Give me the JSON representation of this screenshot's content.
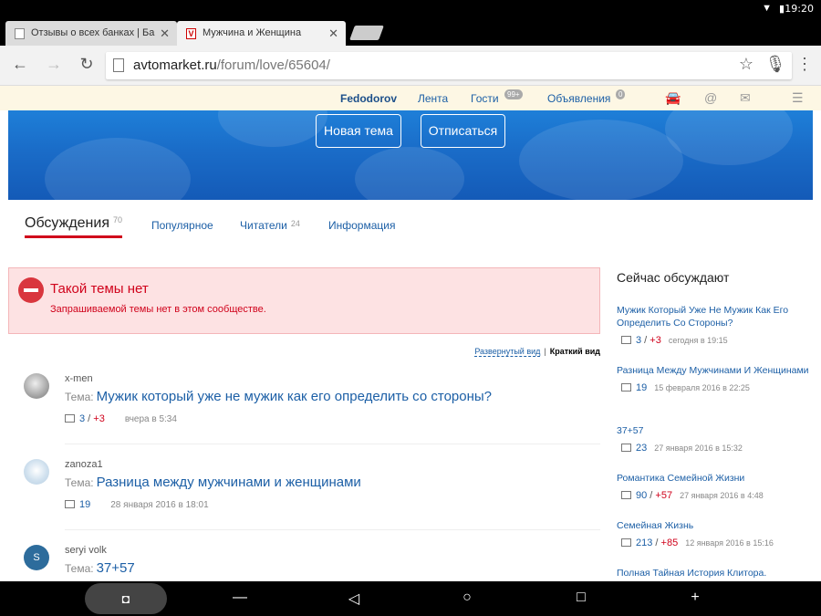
{
  "status": {
    "time": "19:20"
  },
  "browser": {
    "tabs": [
      {
        "title": "Отзывы о всех банках | Ба",
        "active": false
      },
      {
        "title": "Мужчина и Женщина",
        "active": true
      }
    ],
    "url_host": "avtomarket.ru",
    "url_path": "/forum/love/65604/"
  },
  "site_nav": {
    "user": "Fedodorov",
    "feed": "Лента",
    "guests": "Гости",
    "guests_badge": "99+",
    "ads": "Объявления",
    "ads_badge": "0"
  },
  "banner": {
    "new_topic": "Новая тема",
    "unsubscribe": "Отписаться"
  },
  "content_tabs": [
    {
      "label": "Обсуждения",
      "count": "70",
      "active": true
    },
    {
      "label": "Популярное",
      "count": "",
      "active": false
    },
    {
      "label": "Читатели",
      "count": "24",
      "active": false
    },
    {
      "label": "Информация",
      "count": "",
      "active": false
    }
  ],
  "error": {
    "title": "Такой темы нет",
    "text": "Запрашиваемой темы нет в этом сообществе."
  },
  "view_switch": {
    "expanded": "Развернутый вид",
    "separator": "|",
    "brief": "Краткий вид"
  },
  "topic_label": "Тема:",
  "posts": [
    {
      "author": "x-men",
      "topic": "Мужик который уже не мужик как его определить со стороны?",
      "count": "3",
      "plus": "+3",
      "date": "вчера в 5:34",
      "avatar_letter": ""
    },
    {
      "author": "zanoza1",
      "topic": "Разница между мужчинами и женщинами",
      "count": "19",
      "plus": "",
      "date": "28 января 2016 в 18:01",
      "avatar_letter": ""
    },
    {
      "author": "seryi volk",
      "topic": "37+57",
      "count": "",
      "plus": "",
      "date": "",
      "avatar_letter": "S"
    }
  ],
  "sidebar": {
    "title": "Сейчас обсуждают",
    "items": [
      {
        "title": "Мужик Который Уже Не Мужик Как Его Определить Со Стороны?",
        "count": "3",
        "plus": "+3",
        "date": "сегодня в 19:15"
      },
      {
        "title": "Разница Между Мужчинами И Женщинами",
        "count": "19",
        "plus": "",
        "date": "15 февраля 2016 в 22:25"
      },
      {
        "title": "37+57",
        "count": "23",
        "plus": "",
        "date": "27 января 2016 в 15:32"
      },
      {
        "title": "Романтика Семейной Жизни",
        "count": "90",
        "plus": "+57",
        "date": "27 января 2016 в 4:48"
      },
      {
        "title": "Семейная Жизнь",
        "count": "213",
        "plus": "+85",
        "date": "12 января 2016 в 15:16"
      },
      {
        "title": "Полная Тайная История Клитора.",
        "count": "",
        "plus": "",
        "date": ""
      }
    ]
  },
  "icons": {
    "wifi": "wifi-icon",
    "battery": "battery-icon",
    "back": "back-arrow-icon",
    "forward": "forward-arrow-icon",
    "reload": "reload-icon",
    "star": "star-icon",
    "mic": "mic-icon",
    "menu": "overflow-menu-icon",
    "car": "car-icon",
    "at": "at-icon",
    "mail": "mail-icon",
    "hamburger": "hamburger-icon"
  }
}
